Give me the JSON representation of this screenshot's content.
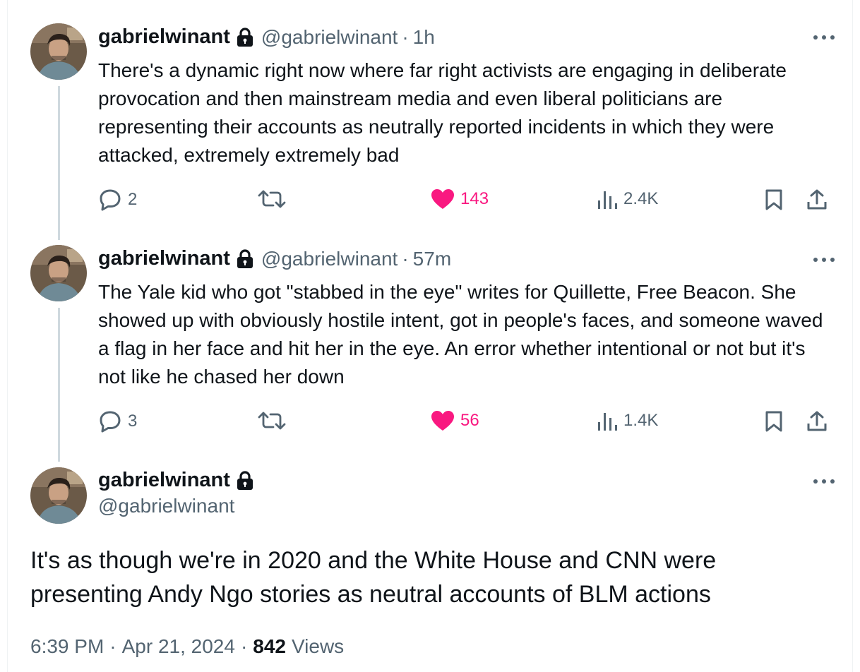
{
  "tweets": [
    {
      "display_name": "gabrielwinant",
      "handle": "@gabrielwinant",
      "separator": "·",
      "time": "1h",
      "text": "There's a dynamic right now where far right activists are engaging in deliberate provocation and then mainstream media and even liberal politicians are representing their accounts as neutrally reported incidents in which they were attacked, extremely extremely bad",
      "replies": "2",
      "retweets": "",
      "likes": "143",
      "views": "2.4K"
    },
    {
      "display_name": "gabrielwinant",
      "handle": "@gabrielwinant",
      "separator": "·",
      "time": "57m",
      "text": "The Yale kid who got \"stabbed in the eye\" writes for Quillette, Free Beacon. She showed up with obviously hostile intent, got in people's faces, and someone waved a flag in her face and hit her in the eye. An error whether intentional or not but it's not like he chased her down",
      "replies": "3",
      "retweets": "",
      "likes": "56",
      "views": "1.4K"
    }
  ],
  "main_tweet": {
    "display_name": "gabrielwinant",
    "handle": "@gabrielwinant",
    "text": "It's as though we're in 2020 and the White House and CNN were presenting Andy Ngo stories as neutral accounts of BLM actions",
    "time": "6:39 PM",
    "date": "Apr 21, 2024",
    "separator": "·",
    "views_count": "842",
    "views_label": "Views"
  },
  "icons": {
    "protected": "lock-icon",
    "more": "more-icon",
    "reply": "reply-icon",
    "retweet": "retweet-icon",
    "like": "heart-filled-icon",
    "views": "views-chart-icon",
    "bookmark": "bookmark-icon",
    "share": "share-icon"
  },
  "colors": {
    "text": "#0f1419",
    "secondary": "#536471",
    "like": "#f91880",
    "thread_line": "#cfd9de"
  }
}
